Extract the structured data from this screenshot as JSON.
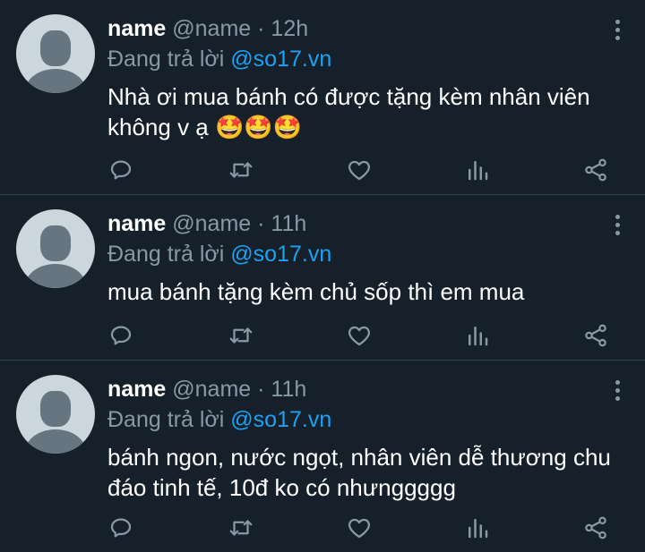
{
  "tweets": [
    {
      "name": "name",
      "handle": "@name",
      "time": "12h",
      "reply_prefix": "Đang trả lời",
      "reply_to": "@so17.vn",
      "text": "Nhà ơi mua bánh có được tặng kèm nhân viên không v ạ 🤩🤩🤩"
    },
    {
      "name": "name",
      "handle": "@name",
      "time": "11h",
      "reply_prefix": "Đang trả lời",
      "reply_to": "@so17.vn",
      "text": "mua bánh tặng kèm chủ sốp thì em mua"
    },
    {
      "name": "name",
      "handle": "@name",
      "time": "11h",
      "reply_prefix": "Đang trả lời",
      "reply_to": "@so17.vn",
      "text": "bánh ngon, nước ngọt, nhân viên dễ thương chu đáo tinh tế, 10đ ko có nhưnggggg"
    }
  ],
  "separator": "·",
  "colors": {
    "background": "#15202b",
    "secondary_text": "#8899a6",
    "accent": "#1da1f2",
    "divider": "#38444d"
  },
  "icons": [
    "reply-icon",
    "retweet-icon",
    "like-icon",
    "analytics-icon",
    "share-icon",
    "more-icon"
  ]
}
